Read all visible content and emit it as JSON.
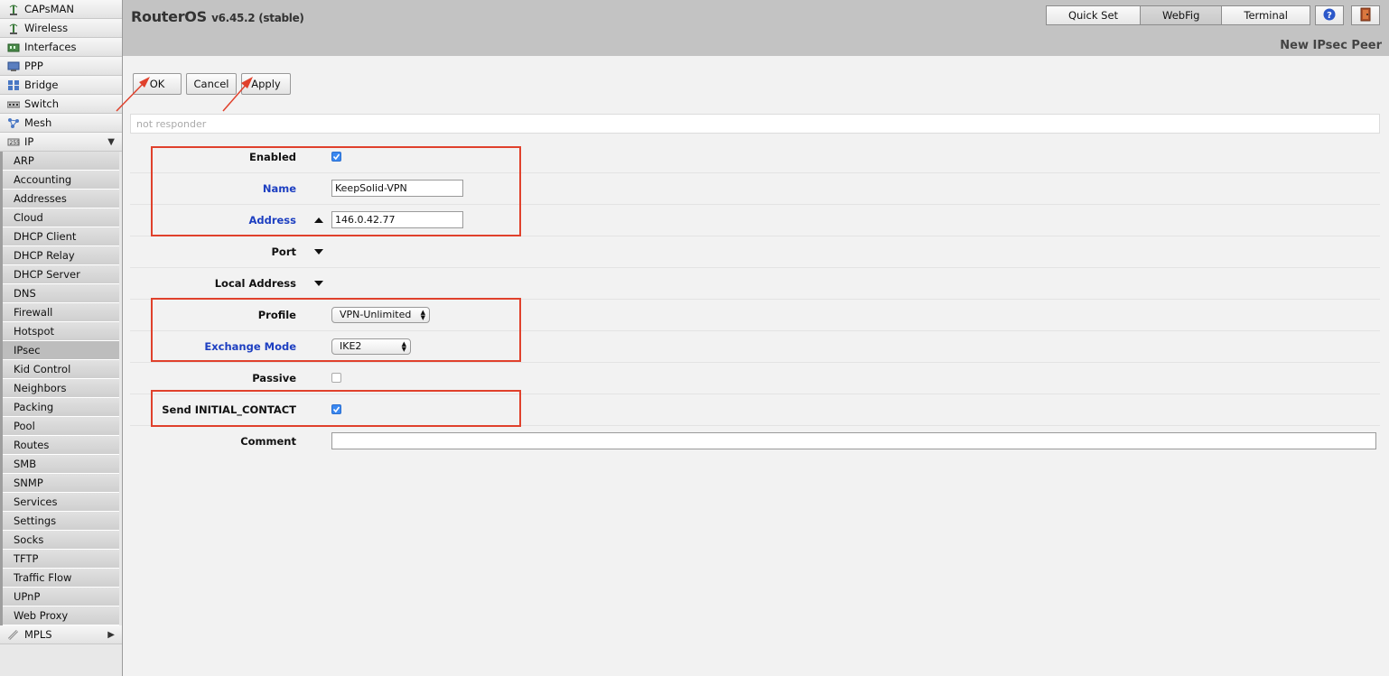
{
  "app": {
    "name": "RouterOS",
    "version": "v6.45.2 (stable)"
  },
  "header_tabs": [
    {
      "label": "Quick Set"
    },
    {
      "label": "WebFig",
      "active": true
    },
    {
      "label": "Terminal"
    }
  ],
  "header_icons": [
    "help-icon",
    "logout-door-icon"
  ],
  "page_heading": "New IPsec Peer",
  "sidebar": {
    "top_items": [
      {
        "label": "CAPsMAN",
        "icon": "capsman-antenna-icon"
      },
      {
        "label": "Wireless",
        "icon": "wireless-antenna-icon"
      },
      {
        "label": "Interfaces",
        "icon": "interfaces-icon"
      },
      {
        "label": "PPP",
        "icon": "ppp-icon"
      },
      {
        "label": "Bridge",
        "icon": "bridge-icon"
      },
      {
        "label": "Switch",
        "icon": "switch-icon"
      },
      {
        "label": "Mesh",
        "icon": "mesh-icon"
      },
      {
        "label": "IP",
        "icon": "ip-icon",
        "expanded": true
      }
    ],
    "ip_sub_items": [
      "ARP",
      "Accounting",
      "Addresses",
      "Cloud",
      "DHCP Client",
      "DHCP Relay",
      "DHCP Server",
      "DNS",
      "Firewall",
      "Hotspot",
      "IPsec",
      "Kid Control",
      "Neighbors",
      "Packing",
      "Pool",
      "Routes",
      "SMB",
      "SNMP",
      "Services",
      "Settings",
      "Socks",
      "TFTP",
      "Traffic Flow",
      "UPnP",
      "Web Proxy"
    ],
    "active_sub_item": "IPsec",
    "bottom_item": {
      "label": "MPLS",
      "icon": "mpls-icon"
    }
  },
  "buttons": {
    "ok": "OK",
    "cancel": "Cancel",
    "apply": "Apply"
  },
  "status_text": "not responder",
  "form": {
    "enabled": {
      "label": "Enabled",
      "checked": true
    },
    "name": {
      "label": "Name",
      "value": "KeepSolid-VPN"
    },
    "address": {
      "label": "Address",
      "value": "146.0.42.77"
    },
    "port": {
      "label": "Port"
    },
    "local_address": {
      "label": "Local Address"
    },
    "profile": {
      "label": "Profile",
      "value": "VPN-Unlimited"
    },
    "exchange_mode": {
      "label": "Exchange Mode",
      "value": "IKE2"
    },
    "passive": {
      "label": "Passive",
      "checked": false
    },
    "send_initial_contact": {
      "label": "Send INITIAL_CONTACT",
      "checked": true
    },
    "comment": {
      "label": "Comment",
      "value": ""
    }
  },
  "colors": {
    "annotation_red": "#e0412c",
    "required_label_blue": "#1d3fc1",
    "checkbox_blue": "#3b88f0"
  }
}
